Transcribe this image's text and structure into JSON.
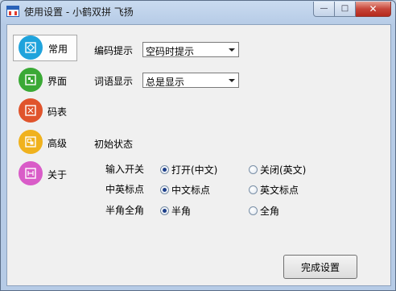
{
  "window": {
    "title": "使用设置 - 小鹤双拼 飞扬"
  },
  "caption_buttons": {
    "minimize": "—",
    "maximize": "□",
    "close": "✕"
  },
  "nav": {
    "items": [
      {
        "label": "常用",
        "icon": "square-diamond-icon",
        "color": "#1fa3dc",
        "selected": true
      },
      {
        "label": "界面",
        "icon": "layout-icon",
        "color": "#3aa935",
        "selected": false
      },
      {
        "label": "码表",
        "icon": "code-table-icon",
        "color": "#e0542c",
        "selected": false
      },
      {
        "label": "高级",
        "icon": "advanced-icon",
        "color": "#f0b21e",
        "selected": false
      },
      {
        "label": "关于",
        "icon": "about-icon",
        "color": "#d95cc8",
        "selected": false
      }
    ]
  },
  "settings": {
    "encoding_hint": {
      "label": "编码提示",
      "value": "空码时提示"
    },
    "word_display": {
      "label": "词语显示",
      "value": "总是显示"
    },
    "initial_state": {
      "heading": "初始状态",
      "rows": [
        {
          "label": "输入开关",
          "option_a": "打开(中文)",
          "option_b": "关闭(英文)",
          "selected": "a"
        },
        {
          "label": "中英标点",
          "option_a": "中文标点",
          "option_b": "英文标点",
          "selected": "a"
        },
        {
          "label": "半角全角",
          "option_a": "半角",
          "option_b": "全角",
          "selected": "a"
        }
      ]
    }
  },
  "footer": {
    "finish_label": "完成设置"
  }
}
